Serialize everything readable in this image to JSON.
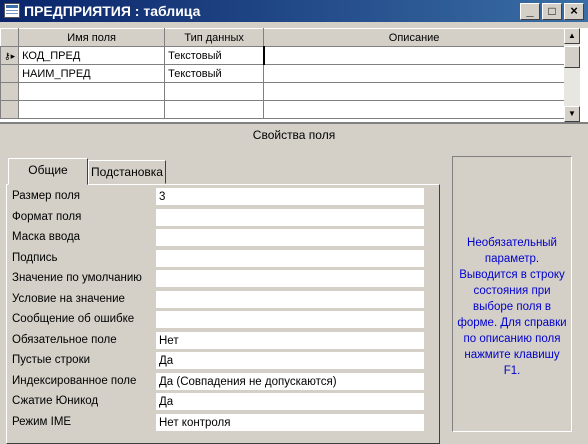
{
  "window": {
    "title": "ПРЕДПРИЯТИЯ : таблица",
    "minimize": "_",
    "maximize": "□",
    "close": "×"
  },
  "grid": {
    "columns": [
      "Имя поля",
      "Тип данных",
      "Описание"
    ],
    "rows": [
      {
        "name": "КОД_ПРЕД",
        "type": "Текстовый",
        "desc": ""
      },
      {
        "name": "НАИМ_ПРЕД",
        "type": "Текстовый",
        "desc": ""
      },
      {
        "name": "",
        "type": "",
        "desc": ""
      },
      {
        "name": "",
        "type": "",
        "desc": ""
      },
      {
        "name": "",
        "type": "",
        "desc": ""
      }
    ],
    "key_marker": "⚷▸"
  },
  "props": {
    "header": "Свойства поля",
    "tabs": [
      "Общие",
      "Подстановка"
    ],
    "rows": [
      {
        "label": "Размер поля",
        "value": "3"
      },
      {
        "label": "Формат поля",
        "value": ""
      },
      {
        "label": "Маска ввода",
        "value": ""
      },
      {
        "label": "Подпись",
        "value": ""
      },
      {
        "label": "Значение по умолчанию",
        "value": ""
      },
      {
        "label": "Условие на значение",
        "value": ""
      },
      {
        "label": "Сообщение об ошибке",
        "value": ""
      },
      {
        "label": "Обязательное поле",
        "value": "Нет"
      },
      {
        "label": "Пустые строки",
        "value": "Да"
      },
      {
        "label": "Индексированное поле",
        "value": "Да (Совпадения не допускаются)"
      },
      {
        "label": "Сжатие Юникод",
        "value": "Да"
      },
      {
        "label": "Режим IME",
        "value": "Нет контроля"
      }
    ],
    "hint": "Необязательный параметр. Выводится в строку состояния при выборе поля в форме.  Для справки по описанию поля нажмите клавишу F1."
  }
}
